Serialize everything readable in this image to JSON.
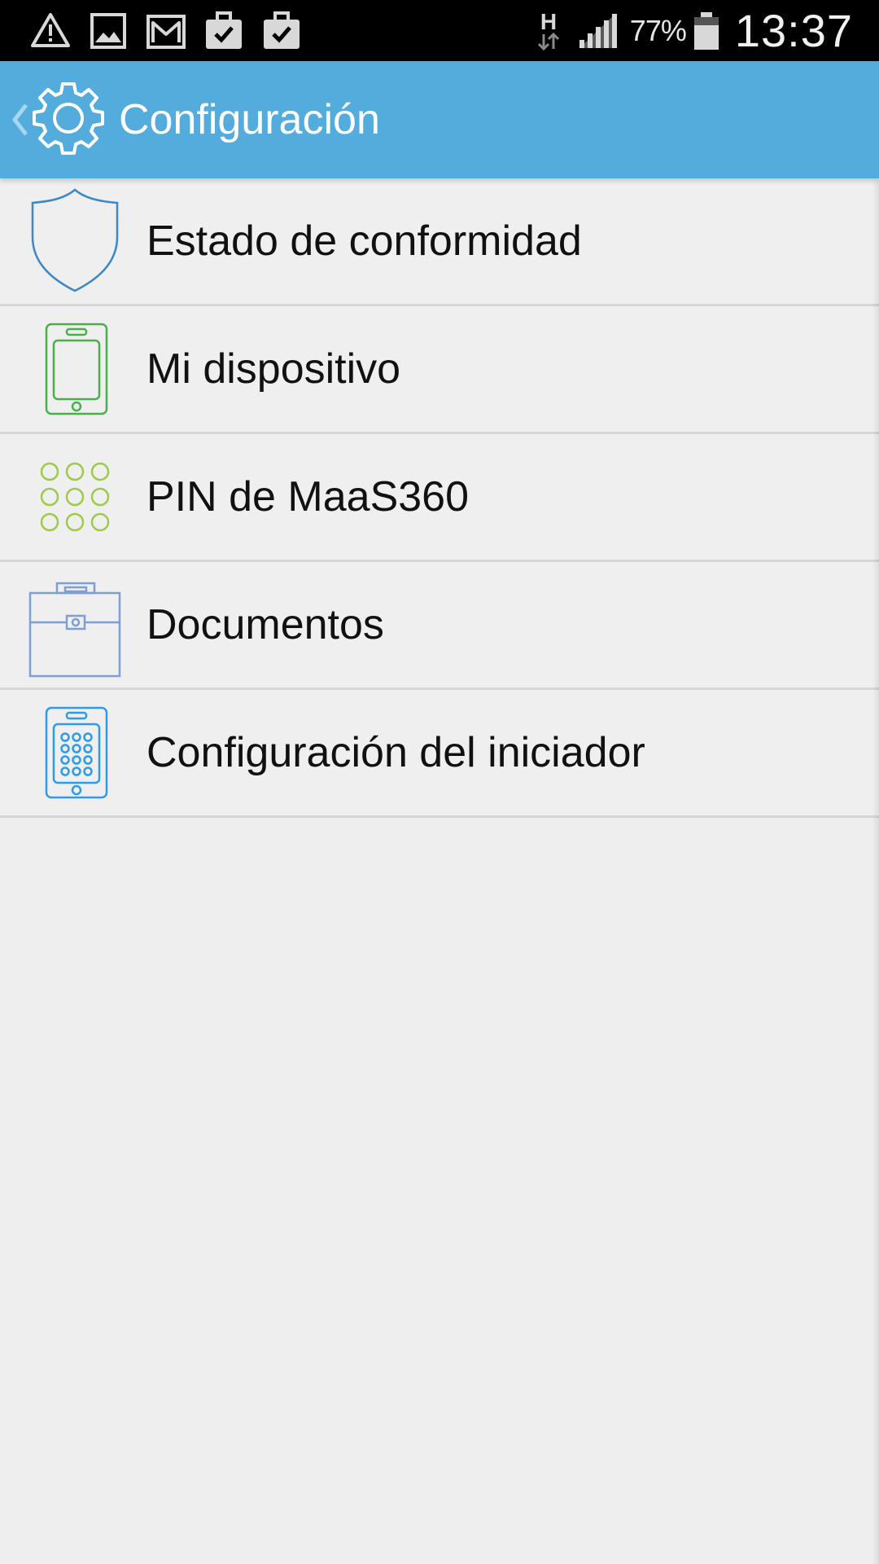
{
  "status_bar": {
    "notification_icons": [
      "warning-icon",
      "image-icon",
      "gmail-icon",
      "briefcase-check-icon",
      "briefcase-check-icon"
    ],
    "network_type": "H",
    "battery_percent": "77%",
    "time": "13:37"
  },
  "app_bar": {
    "back_icon": "chevron-left-icon",
    "logo_icon": "gear-icon",
    "title": "Configuración",
    "background_color": "#53acdb"
  },
  "menu": {
    "items": [
      {
        "label": "Estado de conformidad",
        "icon": "shield-icon",
        "icon_color": "#3a88c8"
      },
      {
        "label": "Mi dispositivo",
        "icon": "smartphone-icon",
        "icon_color": "#47b04b"
      },
      {
        "label": "PIN de MaaS360",
        "icon": "pin-keypad-icon",
        "icon_color": "#9ccb4a"
      },
      {
        "label": "Documentos",
        "icon": "briefcase-icon",
        "icon_color": "#7f9fd4"
      },
      {
        "label": "Configuración del iniciador",
        "icon": "phone-keypad-icon",
        "icon_color": "#2f9ae6"
      }
    ]
  }
}
